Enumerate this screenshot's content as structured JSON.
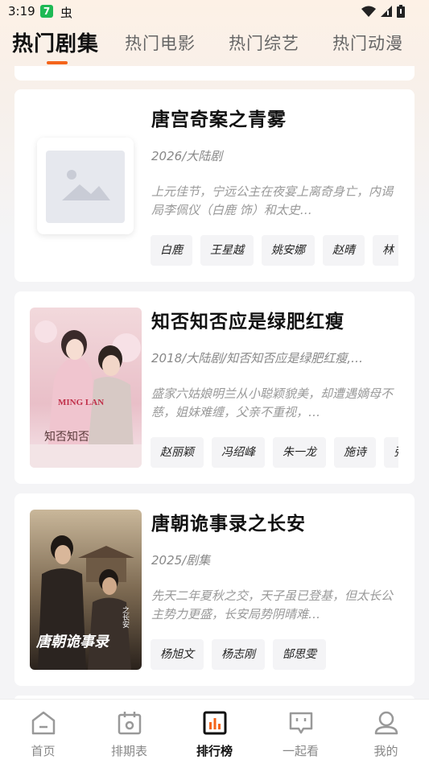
{
  "status_bar": {
    "time": "3:19",
    "badge": "7",
    "app_icon": "虫"
  },
  "tabs": [
    {
      "label": "热门剧集",
      "active": true
    },
    {
      "label": "热门电影",
      "active": false
    },
    {
      "label": "热门综艺",
      "active": false
    },
    {
      "label": "热门动漫",
      "active": false
    }
  ],
  "cards": [
    {
      "title": "唐宫奇案之青雾",
      "meta": "2026/大陆剧",
      "description": "上元佳节，宁远公主在夜宴上离奇身亡，内谒局李佩仪（白鹿 饰）和太史…",
      "cast": [
        "白鹿",
        "王星越",
        "姚安娜",
        "赵晴",
        "林"
      ],
      "poster": "placeholder-image-icon"
    },
    {
      "title": "知否知否应是绿肥红瘦",
      "meta": "2018/大陆剧/知否知否应是绿肥红瘦,…",
      "description": "盛家六姑娘明兰从小聪颖貌美，却遭遇嫡母不慈，姐妹难缠，父亲不重视，…",
      "cast": [
        "赵丽颖",
        "冯绍峰",
        "朱一龙",
        "施诗",
        "张"
      ],
      "poster": "poster-zhifou"
    },
    {
      "title": "唐朝诡事录之长安",
      "meta": "2025/剧集",
      "description": "先天二年夏秋之交，天子虽已登基，但太长公主势力更盛，长安局势阴晴难…",
      "cast": [
        "杨旭文",
        "杨志刚",
        "郜思雯"
      ],
      "poster": "poster-tangchao"
    }
  ],
  "poster_text": {
    "zhifou_logo": "MING LAN",
    "zhifou_calligraphy": "知否知否",
    "tangchao_calligraphy": "唐朝诡事录",
    "tangchao_sub": "之长安"
  },
  "nav": [
    {
      "label": "首页",
      "icon": "home-icon",
      "active": false
    },
    {
      "label": "排期表",
      "icon": "calendar-icon",
      "active": false
    },
    {
      "label": "排行榜",
      "icon": "ranking-icon",
      "active": true
    },
    {
      "label": "一起看",
      "icon": "watch-together-icon",
      "active": false
    },
    {
      "label": "我的",
      "icon": "profile-icon",
      "active": false
    }
  ],
  "colors": {
    "accent": "#f4641a",
    "background": "#f4f4f6",
    "chip_bg": "#f4f4f6"
  }
}
